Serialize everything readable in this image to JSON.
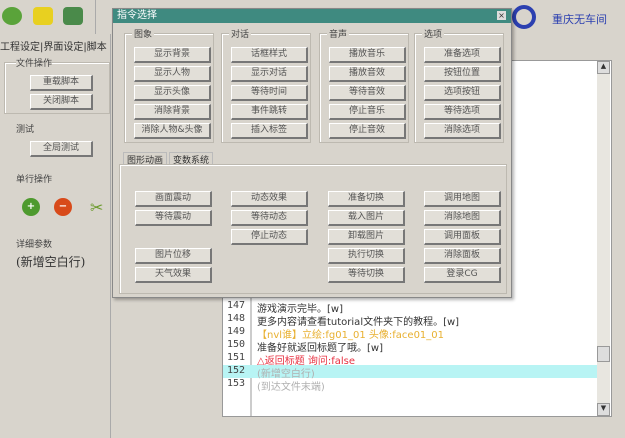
{
  "toolbar": {
    "icons": [
      "add-icon",
      "script-icon",
      "run-icon"
    ]
  },
  "logo": {
    "text": "重庆无车间"
  },
  "left": {
    "tabs": [
      "工程设定",
      "界面设定",
      "脚本"
    ],
    "file_ops": {
      "title": "文件操作",
      "buttons": [
        "重载脚本",
        "关闭脚本"
      ]
    },
    "test": {
      "title": "测试",
      "buttons": [
        "全局测试"
      ]
    },
    "line_ops": {
      "title": "单行操作"
    },
    "details": {
      "title": "详细参数",
      "value": "(新增空白行)"
    }
  },
  "dialog": {
    "title": "指令选择",
    "groups": [
      {
        "title": "图象",
        "buttons": [
          "显示背景",
          "显示人物",
          "显示头像",
          "消除背景",
          "消除人物&头像"
        ]
      },
      {
        "title": "对话",
        "buttons": [
          "话框样式",
          "显示对话",
          "等待时间",
          "事件跳转",
          "插入标签"
        ]
      },
      {
        "title": "音声",
        "buttons": [
          "播放音乐",
          "播放音效",
          "等待音效",
          "停止音乐",
          "停止音效"
        ]
      },
      {
        "title": "选项",
        "buttons": [
          "准备选项",
          "按钮位置",
          "选项按钮",
          "等待选项",
          "消除选项"
        ]
      }
    ],
    "tabs": [
      "图形动画",
      "变数系统"
    ],
    "anim": {
      "col1": [
        "画面震动",
        "等待震动",
        "图片位移",
        "天气效果"
      ],
      "col2": [
        "动态效果",
        "等待动态",
        "停止动态"
      ],
      "col3": [
        "准备切换",
        "载入图片",
        "卸载图片",
        "执行切换",
        "等待切换"
      ],
      "col4": [
        "调用地图",
        "消除地图",
        "调用面板",
        "消除面板",
        "登录CG"
      ]
    }
  },
  "editor": {
    "lines": [
      {
        "num": "147",
        "text": "游戏演示完毕。[w]",
        "color": "#333333"
      },
      {
        "num": "148",
        "text": "更多内容请查看tutorial文件夹下的教程。[w]",
        "color": "#333333"
      },
      {
        "num": "149",
        "text": "【nvl谁】立绘:fg01_01 头像:face01_01",
        "color": "#e8b030"
      },
      {
        "num": "150",
        "text": "准备好就返回标题了哦。[w]",
        "color": "#333333"
      },
      {
        "num": "151",
        "text": "△返回标题 询问:false",
        "color": "#e83040"
      },
      {
        "num": "152",
        "text": "(新增空白行)",
        "color": "#b0b0b0",
        "selected": true
      },
      {
        "num": "153",
        "text": "(到达文件末端)",
        "color": "#b0b0b0"
      }
    ]
  }
}
